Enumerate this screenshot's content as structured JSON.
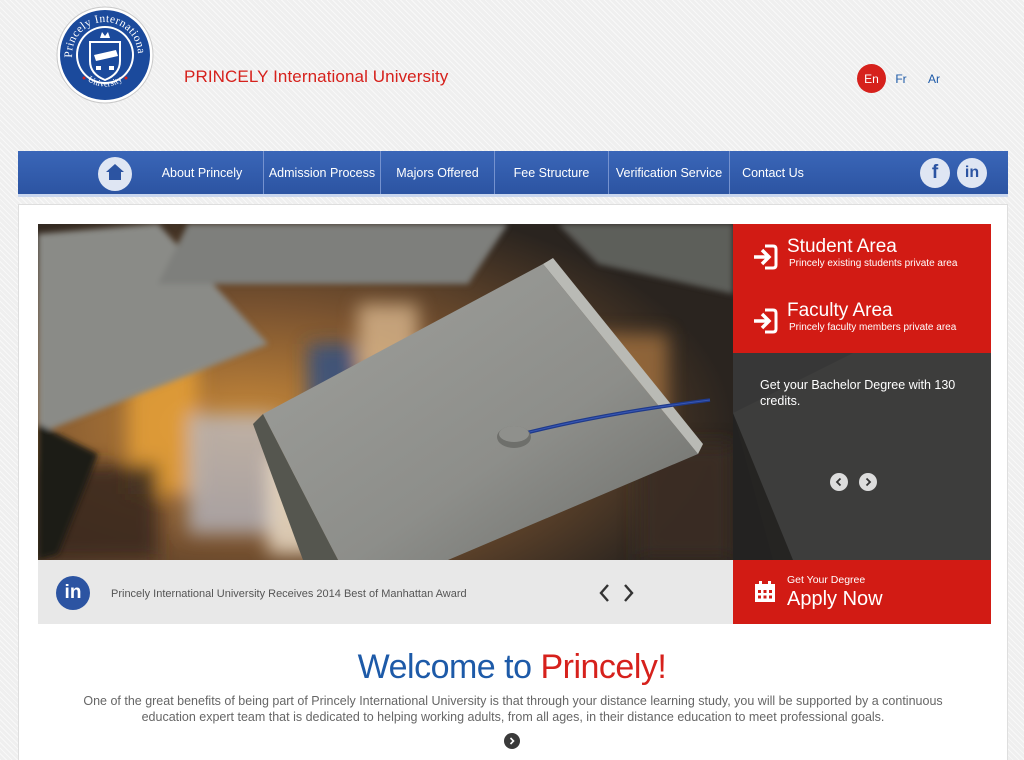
{
  "header": {
    "site_name": "PRINCELY International University",
    "logo": {
      "ring_text_top": "Princely International",
      "ring_text_bottom": "University"
    },
    "languages": [
      "En",
      "Fr",
      "Ar"
    ],
    "active_language": "En"
  },
  "nav": {
    "home_icon": "home-icon",
    "items": [
      "About Princely",
      "Admission Process",
      "Majors Offered",
      "Fee Structure",
      "Verification Service",
      "Contact Us"
    ],
    "social": {
      "facebook": "f",
      "linkedin": "in"
    }
  },
  "hero": {
    "image": "graduation-caps-photo"
  },
  "areas": {
    "student": {
      "title": "Student Area",
      "subtitle": "Princely existing students private area"
    },
    "faculty": {
      "title": "Faculty Area",
      "subtitle": "Princely faculty members private area"
    }
  },
  "promo": {
    "text": "Get your Bachelor Degree with 130 credits."
  },
  "news": {
    "icon_label": "in",
    "text": "Princely International University Receives 2014 Best of Manhattan Award"
  },
  "apply": {
    "small": "Get Your Degree",
    "big": "Apply Now"
  },
  "welcome": {
    "part1": "Welcome to ",
    "part2": "Princely",
    "part3": "!",
    "intro": "One of the great benefits of being part of Princely International University is that through your distance learning study, you will be supported by a continuous education expert team that is dedicated to helping working adults, from all ages, in their distance education to meet professional goals."
  },
  "colors": {
    "brand_red": "#d21b14",
    "brand_blue": "#2c54a2",
    "title_blue": "#1d5aa8"
  }
}
